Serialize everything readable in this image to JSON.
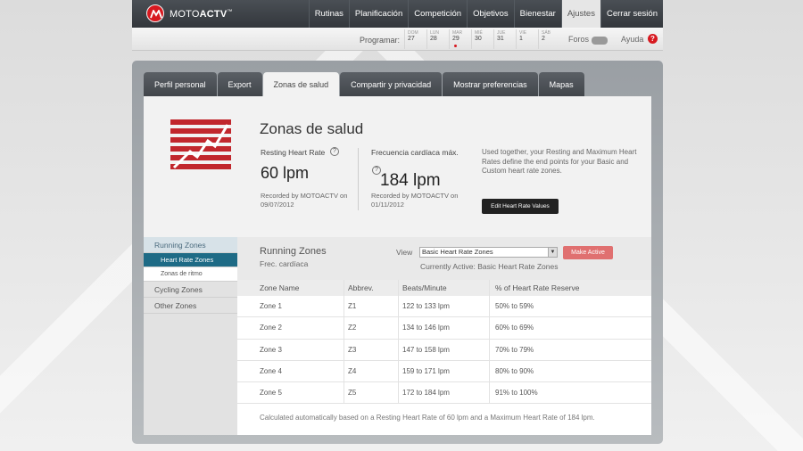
{
  "brand": {
    "name_prefix": "MOTO",
    "name_suffix": "ACTV",
    "tm": "™",
    "logo": "motorola-logo-icon",
    "accent": "#d71920"
  },
  "nav": {
    "items": [
      {
        "label": "Rutinas",
        "active": false
      },
      {
        "label": "Planificación",
        "active": false
      },
      {
        "label": "Competición",
        "active": false
      },
      {
        "label": "Objetivos",
        "active": false
      },
      {
        "label": "Bienestar",
        "active": false
      },
      {
        "label": "Ajustes",
        "active": true
      },
      {
        "label": "Cerrar sesión",
        "active": false
      }
    ]
  },
  "subbar": {
    "program_label": "Programar:",
    "days": [
      {
        "name": "DOM",
        "date": "27"
      },
      {
        "name": "LUN",
        "date": "28"
      },
      {
        "name": "MAR",
        "date": "29"
      },
      {
        "name": "MIÉ",
        "date": "30"
      },
      {
        "name": "JUE",
        "date": "31"
      },
      {
        "name": "VIE",
        "date": "1"
      },
      {
        "name": "SÁB",
        "date": "2"
      }
    ],
    "forums_label": "Foros",
    "help_label": "Ayuda",
    "help_icon": "?"
  },
  "tabs": [
    {
      "label": "Perfil personal",
      "active": false
    },
    {
      "label": "Export",
      "active": false
    },
    {
      "label": "Zonas de salud",
      "active": true
    },
    {
      "label": "Compartir y privacidad",
      "active": false
    },
    {
      "label": "Mostrar preferencias",
      "active": false
    },
    {
      "label": "Mapas",
      "active": false
    }
  ],
  "header": {
    "title": "Zonas de salud",
    "resting": {
      "label": "Resting Heart Rate",
      "help": "?",
      "value": "60 lpm",
      "recorded": "Recorded by MOTOACTV on 09/07/2012"
    },
    "max": {
      "label": "Frecuencia cardíaca máx.",
      "help": "?",
      "value": "184 lpm",
      "recorded": "Recorded by MOTOACTV on 01/11/2012"
    },
    "description": "Used together, your Resting and Maximum Heart Rates define the end points for your Basic and Custom heart rate zones.",
    "edit_button": "Edit Heart Rate Values"
  },
  "sidebar": {
    "items": [
      {
        "label": "Running Zones",
        "type": "head"
      },
      {
        "label": "Heart Rate Zones",
        "type": "sel"
      },
      {
        "label": "Zonas de ritmo",
        "type": "sub"
      },
      {
        "label": "Cycling Zones",
        "type": "item"
      },
      {
        "label": "Other Zones",
        "type": "item"
      }
    ]
  },
  "zones": {
    "title": "Running Zones",
    "subtitle": "Frec. cardíaca",
    "view_label": "View",
    "view_value": "Basic Heart Rate Zones",
    "make_active": "Make Active",
    "active_note": "Currently Active: Basic Heart Rate Zones",
    "columns": [
      "Zone Name",
      "Abbrev.",
      "Beats/Minute",
      "% of Heart Rate Reserve"
    ],
    "rows": [
      [
        "Zone 1",
        "Z1",
        "122 to 133 lpm",
        "50% to 59%"
      ],
      [
        "Zone 2",
        "Z2",
        "134 to 146 lpm",
        "60% to 69%"
      ],
      [
        "Zone 3",
        "Z3",
        "147 to 158 lpm",
        "70% to 79%"
      ],
      [
        "Zone 4",
        "Z4",
        "159 to 171 lpm",
        "80% to 90%"
      ],
      [
        "Zone 5",
        "Z5",
        "172 to 184 lpm",
        "91% to 100%"
      ]
    ],
    "footnote": "Calculated automatically based on a Resting Heart Rate of 60 lpm and a Maximum Heart Rate of 184 lpm."
  }
}
